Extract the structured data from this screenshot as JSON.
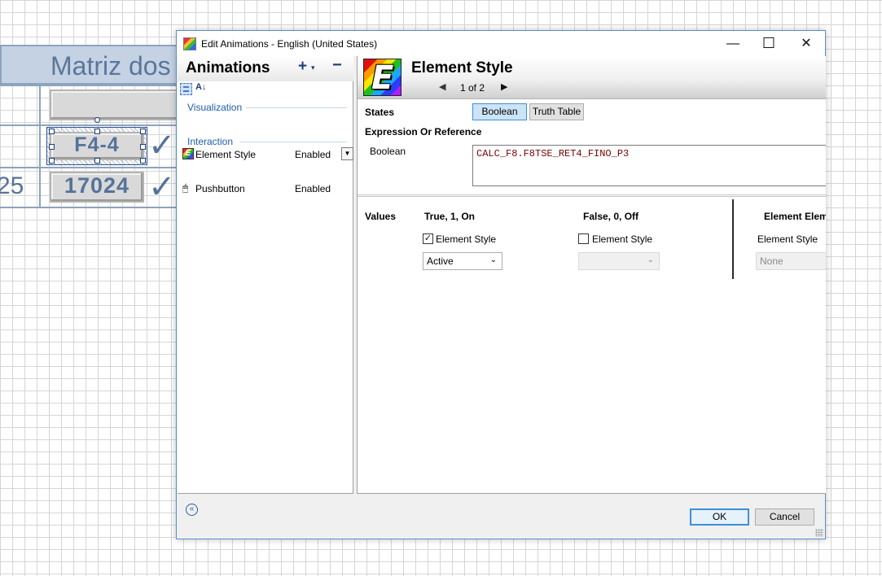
{
  "canvas": {
    "matrix_title": "Matriz dos",
    "cell_f44": "F4-4",
    "cell_17024": "17024",
    "row_number": "25",
    "check_glyph": "✓"
  },
  "window": {
    "title": "Edit Animations - English (United States)",
    "minimize": "—",
    "maximize": "☐",
    "close": "✕"
  },
  "animations": {
    "header": "Animations",
    "add": "+",
    "add_dropdown": "▾",
    "remove": "−",
    "groups": [
      {
        "label": "Visualization",
        "items": [
          {
            "name": "Element Style",
            "state": "Enabled",
            "icon": "element-style-icon"
          }
        ]
      },
      {
        "label": "Interaction",
        "items": [
          {
            "name": "Pushbutton",
            "state": "Enabled",
            "icon": "pushbutton-icon"
          }
        ]
      }
    ]
  },
  "detail": {
    "title": "Element Style",
    "icon_letter": "E",
    "pager": "1 of 2",
    "states_label": "States",
    "tab_boolean": "Boolean",
    "tab_truth_table": "Truth Table",
    "expression_label": "Expression Or Reference",
    "boolean_label": "Boolean",
    "expression_value": "CALC_F8.F8TSE_RET4_FINO_P3",
    "values_label": "Values",
    "true_header": "True, 1, On",
    "false_header": "False, 0, Off",
    "element_header": "Element Elem",
    "true_checkbox_label": "Element Style",
    "false_checkbox_label": "Element Style",
    "third_col_label": "Element Style",
    "true_checked": true,
    "false_checked": false,
    "true_select_value": "Active",
    "false_select_value": "",
    "third_select_value": "None"
  },
  "footer": {
    "ok": "OK",
    "cancel": "Cancel",
    "collapse_icon": "«"
  },
  "colors": {
    "accent": "#3f8fd6",
    "expression_text": "#7a0000",
    "group_label": "#1f5dab"
  }
}
